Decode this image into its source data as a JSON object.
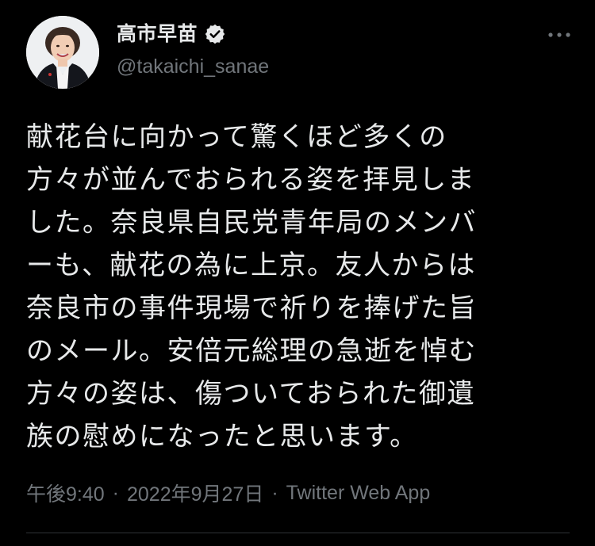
{
  "tweet": {
    "author": {
      "display_name": "高市早苗",
      "handle": "@takaichi_sanae",
      "verified": true,
      "avatar_icon": "profile-photo"
    },
    "more_icon": "more-horizontal-icon",
    "text_lines": [
      "献花台に向かって驚くほど多くの",
      "方々が並んでおられる姿を拝見しま",
      "した。奈良県自民党青年局のメンバ",
      "ーも、献花の為に上京。友人からは",
      "奈良市の事件現場で祈りを捧げた旨",
      "のメール。安倍元総理の急逝を悼む",
      "方々の姿は、傷ついておられた御遺",
      "族の慰めになったと思います。"
    ],
    "meta": {
      "time": "午後9:40",
      "separator": "·",
      "date": "2022年9月27日",
      "source": "Twitter Web App"
    }
  },
  "colors": {
    "background": "#000000",
    "text_primary": "#e7e9ea",
    "text_secondary": "#71767b",
    "divider": "#2f3336"
  }
}
